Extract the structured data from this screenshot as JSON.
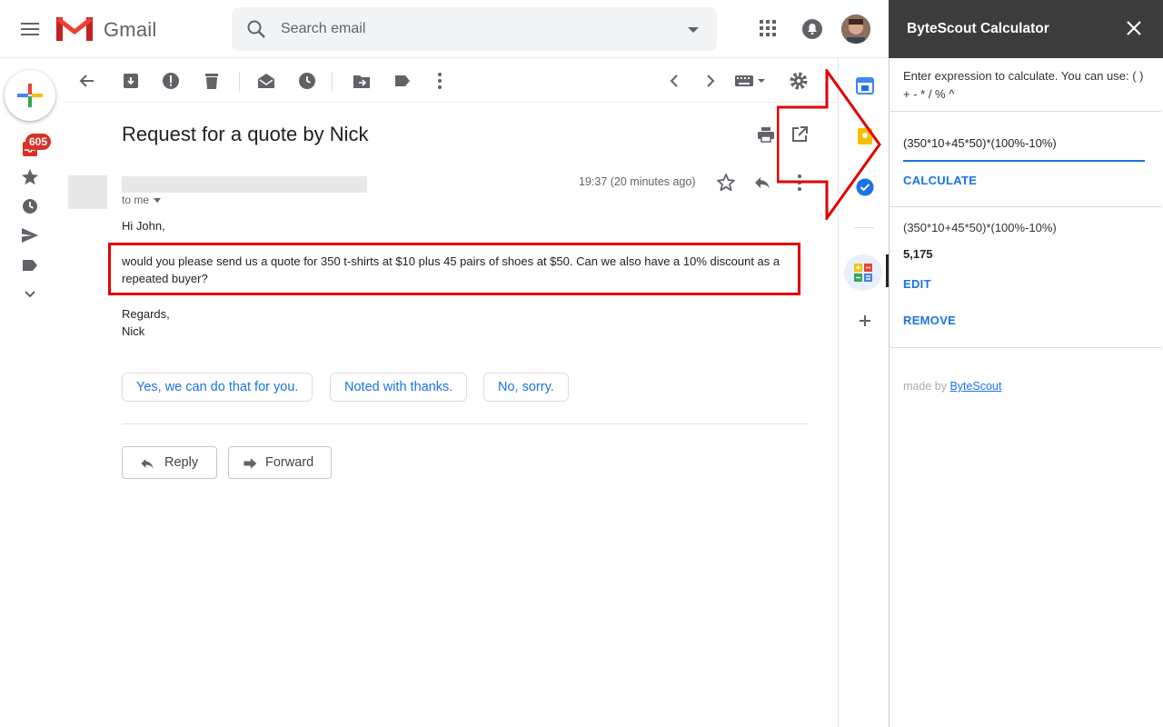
{
  "app": {
    "name": "Gmail"
  },
  "search": {
    "placeholder": "Search email"
  },
  "nav": {
    "inbox_badge": "605"
  },
  "message": {
    "subject": "Request for a quote by Nick",
    "to": "to me",
    "time": "19:37 (20 minutes ago)",
    "greeting": "Hi John,",
    "body_line1": "would you please send us a quote for 350 t-shirts at $10 plus 45 pairs of shoes at $50. Can we also have a 10% discount as a",
    "body_line2": "repeated buyer?",
    "signoff": "Regards,",
    "signature": "Nick"
  },
  "smart_replies": [
    "Yes, we can do that for you.",
    "Noted with thanks.",
    "No, sorry."
  ],
  "actions": {
    "reply": "Reply",
    "forward": "Forward"
  },
  "calculator": {
    "title": "ByteScout Calculator",
    "instructions": "Enter expression to calculate. You can use: ( ) + - * / % ^",
    "expression_input": "(350*10+45*50)*(100%-10%)",
    "calculate_label": "CALCULATE",
    "result_expression": "(350*10+45*50)*(100%-10%)",
    "result_value": "5,175",
    "edit_label": "EDIT",
    "remove_label": "REMOVE",
    "made_by_prefix": "made by",
    "made_by_link": "ByteScout"
  },
  "colors": {
    "accent": "#1a73e8",
    "highlight_red": "#e00000",
    "badge_red": "#d93025",
    "panel_header": "#3c3c3c"
  }
}
